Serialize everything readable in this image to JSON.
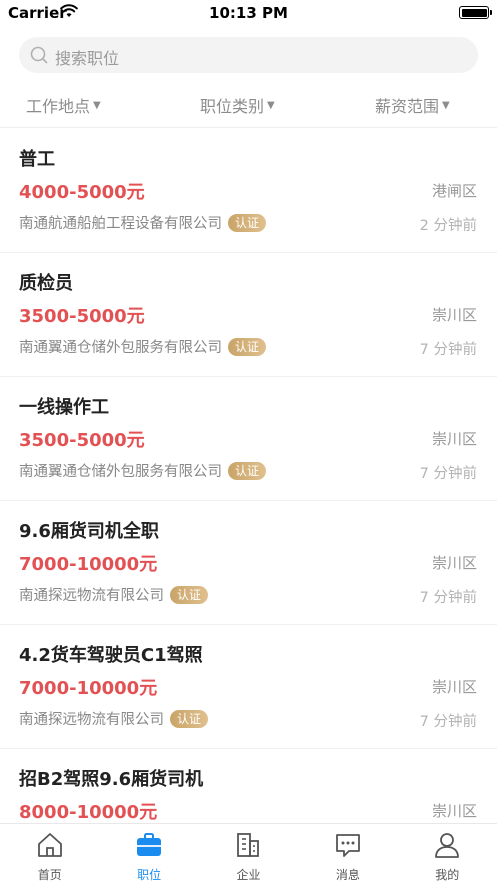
{
  "status_bar": {
    "carrier": "Carrier",
    "time": "10:13 PM"
  },
  "search": {
    "placeholder": "搜索职位"
  },
  "filters": [
    {
      "label": "工作地点"
    },
    {
      "label": "职位类别"
    },
    {
      "label": "薪资范围"
    }
  ],
  "jobs": [
    {
      "title": "普工",
      "salary": "4000-5000元",
      "district": "港闸区",
      "company": "南通航通船舶工程设备有限公司",
      "badge": "认证",
      "time": "2 分钟前"
    },
    {
      "title": "质检员",
      "salary": "3500-5000元",
      "district": "崇川区",
      "company": "南通翼通仓储外包服务有限公司",
      "badge": "认证",
      "time": "7 分钟前"
    },
    {
      "title": "一线操作工",
      "salary": "3500-5000元",
      "district": "崇川区",
      "company": "南通翼通仓储外包服务有限公司",
      "badge": "认证",
      "time": "7 分钟前"
    },
    {
      "title": "9.6厢货司机全职",
      "salary": "7000-10000元",
      "district": "崇川区",
      "company": "南通探远物流有限公司",
      "badge": "认证",
      "time": "7 分钟前"
    },
    {
      "title": "4.2货车驾驶员C1驾照",
      "salary": "7000-10000元",
      "district": "崇川区",
      "company": "南通探远物流有限公司",
      "badge": "认证",
      "time": "7 分钟前"
    },
    {
      "title": "招B2驾照9.6厢货司机",
      "salary": "8000-10000元",
      "district": "崇川区",
      "company": "",
      "badge": "",
      "time": ""
    }
  ],
  "tabs": [
    {
      "label": "首页",
      "icon": "home-icon"
    },
    {
      "label": "职位",
      "icon": "briefcase-icon"
    },
    {
      "label": "企业",
      "icon": "building-icon"
    },
    {
      "label": "消息",
      "icon": "message-icon"
    },
    {
      "label": "我的",
      "icon": "user-icon"
    }
  ],
  "colors": {
    "accent": "#1a8cf0",
    "salary": "#e25254",
    "badge": "#d4b07a"
  }
}
